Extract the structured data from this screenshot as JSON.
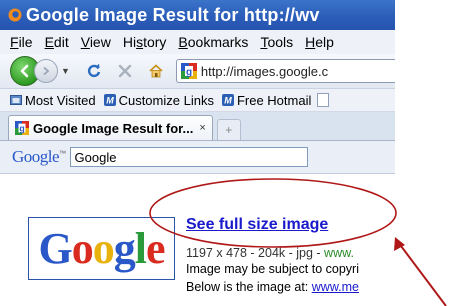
{
  "window": {
    "title": "Google Image Result for http://wv"
  },
  "menu": {
    "items": [
      {
        "accel": "F",
        "rest": "ile"
      },
      {
        "accel": "E",
        "rest": "dit"
      },
      {
        "accel": "V",
        "rest": "iew"
      },
      {
        "pre": "Hi",
        "accel": "s",
        "rest": "tory"
      },
      {
        "accel": "B",
        "rest": "ookmarks"
      },
      {
        "accel": "T",
        "rest": "ools"
      },
      {
        "accel": "H",
        "rest": "elp"
      }
    ]
  },
  "nav": {
    "url": "http://images.google.c"
  },
  "bookmarks": {
    "items": [
      "Most Visited",
      "Customize Links",
      "Free Hotmail"
    ]
  },
  "tab": {
    "label": "Google Image Result for...",
    "close": "×",
    "new": "+"
  },
  "page": {
    "header_logo": "Google",
    "header_logo_tm": "™",
    "search_value": "Google",
    "thumbnail_text": "Google",
    "full_size_link": "See full size image",
    "meta_dims": "1197 x 478 - 204k - jpg - ",
    "meta_domain": "www.",
    "copyright_line": "Image may be subject to copyri",
    "below_prefix": "Below is the image at: ",
    "below_link": "www.me"
  },
  "colors": {
    "titlebar": "#2a5cb8",
    "annotation": "#b01818",
    "link": "#1a1acc",
    "google_blue": "#2a58c8",
    "google_red": "#d92b1f",
    "google_yellow": "#e8b10c",
    "google_green": "#2a9a3a"
  }
}
